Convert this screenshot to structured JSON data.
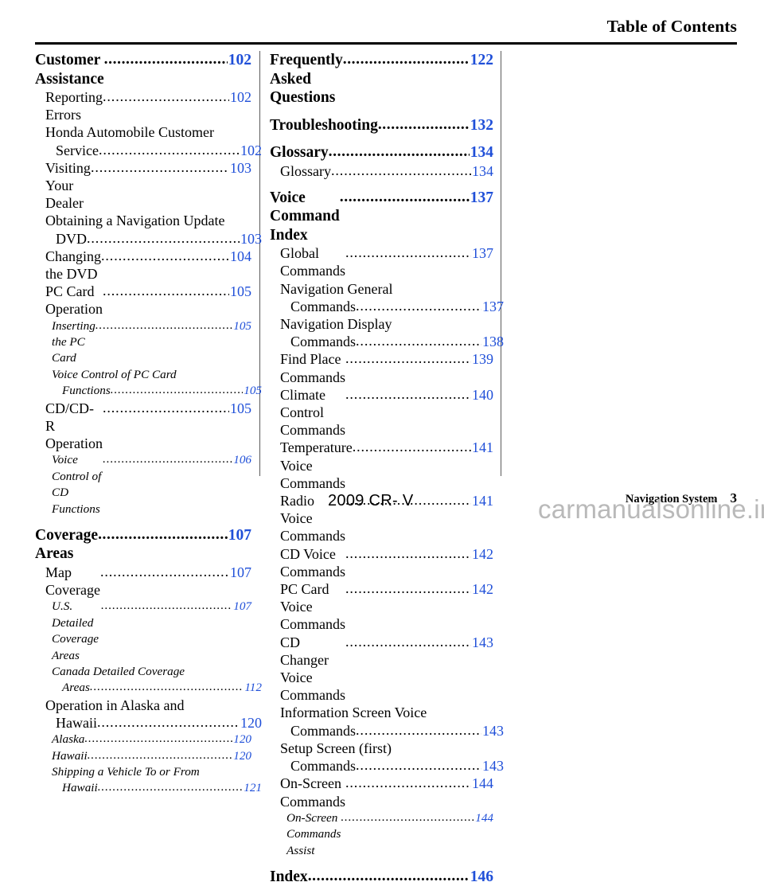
{
  "header": {
    "title": "Table of Contents"
  },
  "footer": {
    "model": "2009  CR- V",
    "section_label": "Navigation System",
    "page_number": "3",
    "watermark": "carmanualsonline.info"
  },
  "colors": {
    "page_number_blue": "#1f4fd8",
    "rule": "#000000",
    "column_rule": "#5a5a5a",
    "watermark": "#b9b9b9"
  },
  "leader_dots": "........................................................................................................",
  "columns": [
    {
      "name": "left-column",
      "entries": [
        {
          "level": 1,
          "text": "Customer Assistance ",
          "page": "102"
        },
        {
          "level": 2,
          "text": "Reporting Errors ",
          "page": "102"
        },
        {
          "level": 2,
          "text": "Honda Automobile Customer",
          "cont": "Service",
          "page": "102"
        },
        {
          "level": 2,
          "text": "Visiting Your Dealer ",
          "page": "103"
        },
        {
          "level": 2,
          "text": "Obtaining a Navigation Update",
          "cont": "DVD ",
          "page": "103"
        },
        {
          "level": 2,
          "text": "Changing the DVD",
          "page": "104"
        },
        {
          "level": 2,
          "text": "PC Card Operation ",
          "page": "105"
        },
        {
          "level": 3,
          "text": "Inserting the PC Card",
          "page": "105"
        },
        {
          "level": 3,
          "text": "Voice Control of PC Card",
          "cont": "Functions",
          "page": "105"
        },
        {
          "level": 2,
          "text": "CD/CD-R Operation",
          "page": "105"
        },
        {
          "level": 3,
          "text": "Voice Control of CD Functions ",
          "page": "106"
        },
        {
          "level": 1,
          "text": "Coverage Areas",
          "page": "107",
          "gap": true
        },
        {
          "level": 2,
          "text": "Map Coverage ",
          "page": "107"
        },
        {
          "level": 3,
          "text": "U.S. Detailed Coverage Areas",
          "page": "107"
        },
        {
          "level": 3,
          "text": "Canada Detailed Coverage",
          "cont": "Areas ",
          "page": "112"
        },
        {
          "level": 2,
          "text": "Operation in Alaska and",
          "cont": "Hawaii ",
          "page": "120"
        },
        {
          "level": 3,
          "text": "Alaska ",
          "page": "120"
        },
        {
          "level": 3,
          "text": "Hawaii ",
          "page": "120"
        },
        {
          "level": 3,
          "text": "Shipping a Vehicle To or From",
          "cont": "Hawaii",
          "page": "121"
        }
      ]
    },
    {
      "name": "right-column",
      "entries": [
        {
          "level": 1,
          "text": "Frequently Asked Questions",
          "page": "122"
        },
        {
          "level": 1,
          "text": "Troubleshooting",
          "page": "132",
          "gap": true
        },
        {
          "level": 1,
          "text": "Glossary ",
          "page": "134",
          "gap": true
        },
        {
          "level": 2,
          "text": "Glossary ",
          "page": "134"
        },
        {
          "level": 1,
          "text": "Voice Command Index",
          "page": "137",
          "gap": true
        },
        {
          "level": 2,
          "text": "Global Commands ",
          "page": "137"
        },
        {
          "level": 2,
          "text": "Navigation General",
          "cont": "Commands ",
          "page": "137"
        },
        {
          "level": 2,
          "text": "Navigation Display",
          "cont": "Commands",
          "page": "138"
        },
        {
          "level": 2,
          "text": "Find Place Commands ",
          "page": "139"
        },
        {
          "level": 2,
          "text": "Climate Control Commands ",
          "page": "140"
        },
        {
          "level": 2,
          "text": "Temperature Voice Commands ",
          "page": "141"
        },
        {
          "level": 2,
          "text": "Radio Voice Commands",
          "page": "141"
        },
        {
          "level": 2,
          "text": "CD Voice Commands ",
          "page": "142"
        },
        {
          "level": 2,
          "text": "PC Card Voice Commands",
          "page": "142"
        },
        {
          "level": 2,
          "text": "CD Changer Voice Commands ",
          "page": "143"
        },
        {
          "level": 2,
          "text": "Information Screen Voice",
          "cont": "Commands ",
          "page": "143"
        },
        {
          "level": 2,
          "text": "Setup Screen (first)",
          "cont": "Commands ",
          "page": "143"
        },
        {
          "level": 2,
          "text": "On-Screen Commands ",
          "page": "144"
        },
        {
          "level": 3,
          "text": "On-Screen Commands Assist",
          "page": "144"
        },
        {
          "level": 1,
          "text": "Index ",
          "page": "146",
          "gap": true
        }
      ]
    }
  ]
}
